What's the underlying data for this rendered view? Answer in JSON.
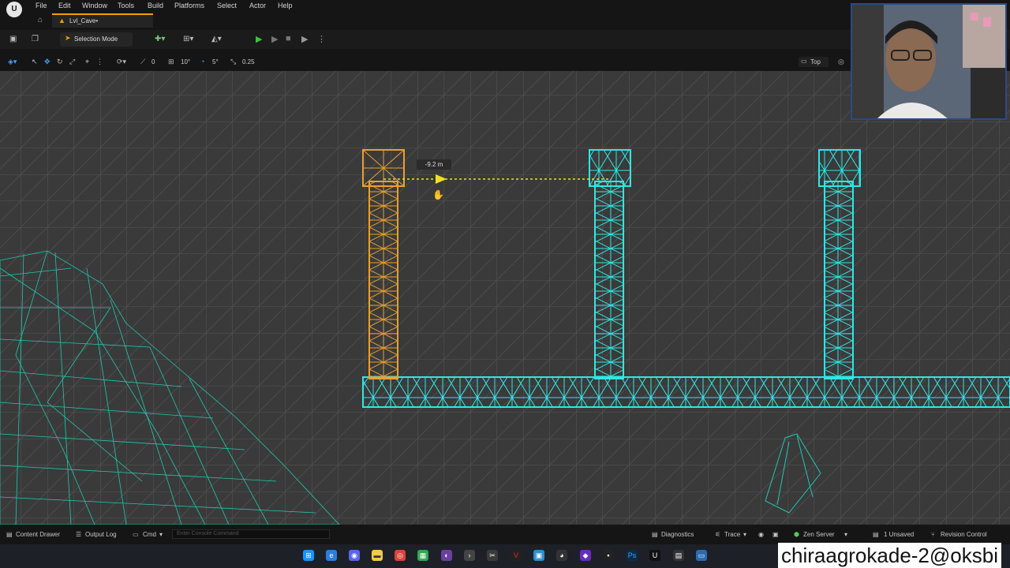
{
  "menu": [
    "File",
    "Edit",
    "Window",
    "Tools",
    "Build",
    "Platforms",
    "Select",
    "Actor",
    "Help"
  ],
  "level_tab": "Lvl_Cave•",
  "toolbar": {
    "mode_label": "Selection Mode"
  },
  "viewport_controls": {
    "angle_snap": "10°",
    "rotation_snap": "5°",
    "scale_snap": "0.25",
    "grid_val": "0",
    "view_label": "Top"
  },
  "measure": {
    "label": "-9.2 m"
  },
  "bottom": {
    "content_drawer": "Content Drawer",
    "output_log": "Output Log",
    "cmd": "Cmd",
    "console_placeholder": "Enter Console Command",
    "diagnostics": "Diagnostics",
    "trace": "Trace",
    "zen_server": "Zen Server",
    "unsaved": "1 Unsaved",
    "revision_control": "Revision Control"
  },
  "watermark": "chiraagrokade-2@oksbi",
  "colors": {
    "selected": "#e8a030",
    "cyan": "#30e6e6",
    "teal_wire": "#1ec9b0",
    "grid": "#5a5a5a"
  }
}
